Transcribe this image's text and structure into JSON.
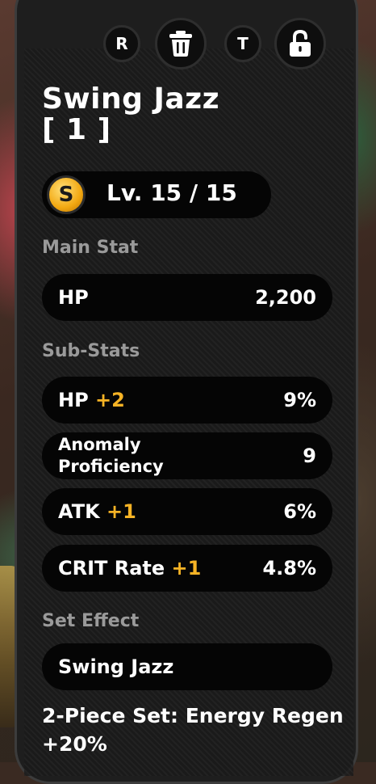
{
  "disc": {
    "title": "Swing Jazz",
    "slot": "[ 1 ]",
    "rank_badge": "S",
    "level": "Lv. 15 / 15"
  },
  "toolbar": {
    "r_label": "R",
    "t_label": "T",
    "delete_icon": "trash-icon",
    "lock_icon": "unlock-icon"
  },
  "main_stat": {
    "section_label": "Main Stat",
    "name": "HP",
    "value": "2,200"
  },
  "sub_stats": {
    "section_label": "Sub-Stats",
    "items": [
      {
        "name": "HP",
        "upgrade": "+2",
        "value": "9%"
      },
      {
        "name": "Anomaly Proficiency",
        "upgrade": "",
        "value": "9"
      },
      {
        "name": "ATK",
        "upgrade": "+1",
        "value": "6%"
      },
      {
        "name": "CRIT Rate",
        "upgrade": "+1",
        "value": "4.8%"
      }
    ]
  },
  "set_effect": {
    "section_label": "Set Effect",
    "name": "Swing Jazz",
    "description": "2-Piece Set: Energy Regen +20%"
  },
  "colors": {
    "accent": "#f6b325",
    "panel": "#1e1e1e",
    "pill": "#050505",
    "section_label": "#9a9a9a"
  }
}
